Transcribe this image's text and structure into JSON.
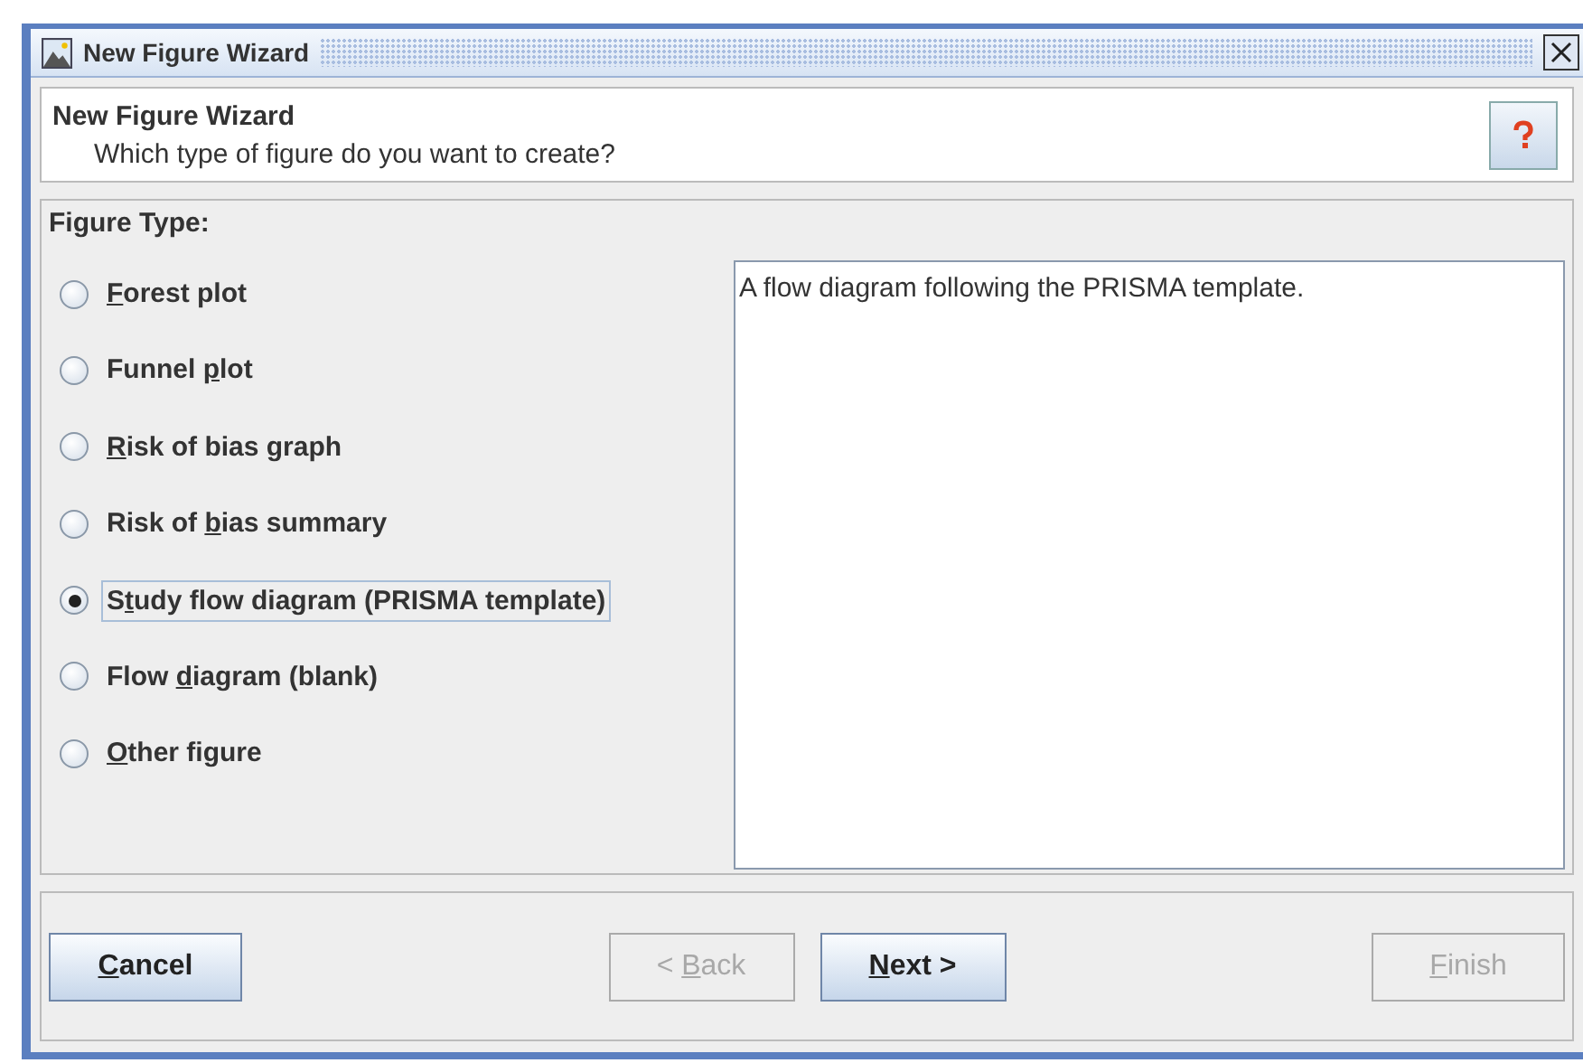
{
  "window": {
    "title": "New Figure Wizard"
  },
  "header": {
    "title": "New Figure Wizard",
    "subtitle": "Which type of figure do you want to create?"
  },
  "figure_type": {
    "label": "Figure Type:",
    "options": [
      {
        "key": "F",
        "post": "orest plot",
        "selected": false
      },
      {
        "pre": "Funnel ",
        "key": "p",
        "post": "lot",
        "selected": false
      },
      {
        "key": "R",
        "post": "isk of bias graph",
        "selected": false
      },
      {
        "pre": "Risk of ",
        "key": "b",
        "post": "ias summary",
        "selected": false
      },
      {
        "pre": "S",
        "key": "t",
        "post": "udy flow diagram (PRISMA template)",
        "selected": true
      },
      {
        "pre": "Flow ",
        "key": "d",
        "post": "iagram (blank)",
        "selected": false
      },
      {
        "key": "O",
        "post": "ther figure",
        "selected": false
      }
    ],
    "description": "A flow diagram following the PRISMA template."
  },
  "buttons": {
    "left": [
      {
        "key": "C",
        "post": "ancel",
        "disabled": false
      }
    ],
    "center": [
      {
        "pre": "< ",
        "key": "B",
        "post": "ack",
        "disabled": true
      },
      {
        "key": "N",
        "post": "ext >",
        "disabled": false
      }
    ],
    "right": [
      {
        "key": "F",
        "post": "inish",
        "disabled": true
      }
    ]
  }
}
